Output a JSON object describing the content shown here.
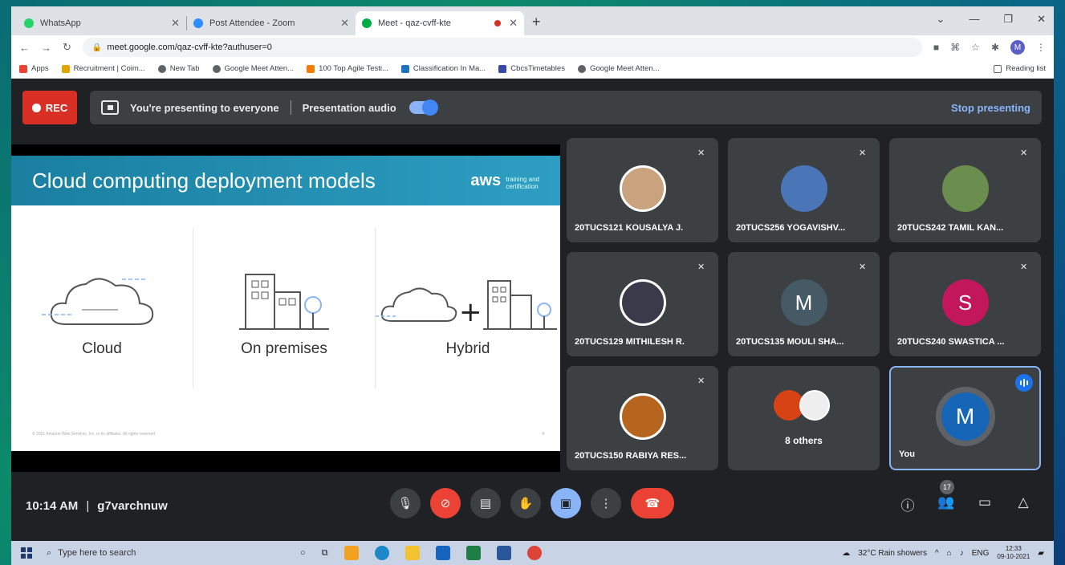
{
  "browser": {
    "tabs": [
      {
        "title": "WhatsApp",
        "color": "#25d366",
        "active": false
      },
      {
        "title": "Post Attendee - Zoom",
        "color": "#2d8cff",
        "active": false
      },
      {
        "title": "Meet - qaz-cvff-kte",
        "color": "#00ac47",
        "active": true
      }
    ],
    "url": "meet.google.com/qaz-cvff-kte?authuser=0",
    "profile_initial": "M",
    "bookmarks": [
      {
        "label": "Apps",
        "color": "#ea4335"
      },
      {
        "label": "Recruitment | Coim...",
        "color": "#e3a400"
      },
      {
        "label": "New Tab",
        "color": "#5f6368"
      },
      {
        "label": "Google Meet Atten...",
        "color": "#5f6368"
      },
      {
        "label": "100 Top Agile Testi...",
        "color": "#f57c00"
      },
      {
        "label": "Classification In Ma...",
        "color": "#1e73be"
      },
      {
        "label": "CbcsTimetables",
        "color": "#3949ab"
      },
      {
        "label": "Google Meet Atten...",
        "color": "#5f6368"
      }
    ],
    "reading_list": "Reading list"
  },
  "meet": {
    "rec_label": "REC",
    "presenting_text": "You're presenting to everyone",
    "presentation_audio": "Presentation audio",
    "stop_presenting": "Stop presenting",
    "slide": {
      "title": "Cloud computing deployment models",
      "aws_logo": "aws",
      "aws_sub1": "training and",
      "aws_sub2": "certification",
      "models": [
        "Cloud",
        "On premises",
        "Hybrid"
      ],
      "copyright": "© 2021 Amazon Web Services, Inc. or its affiliates. All rights reserved.",
      "slide_number": "4"
    },
    "participants": [
      {
        "name": "20TUCS121 KOUSALYA J.",
        "avatar": "photo",
        "color": "#c9a27e"
      },
      {
        "name": "20TUCS256 YOGAVISHV...",
        "avatar": "photo",
        "color": "#4a76b8"
      },
      {
        "name": "20TUCS242 TAMIL KAN...",
        "avatar": "photo",
        "color": "#6b8e4e"
      },
      {
        "name": "20TUCS129 MITHILESH R.",
        "avatar": "photo",
        "color": "#3a3a4a"
      },
      {
        "name": "20TUCS135 MOULI SHA...",
        "avatar": "initial",
        "initial": "M",
        "color": "#455a64"
      },
      {
        "name": "20TUCS240 SWASTICA ...",
        "avatar": "initial",
        "initial": "S",
        "color": "#c2185b"
      },
      {
        "name": "20TUCS150 RABIYA RES...",
        "avatar": "photo",
        "color": "#b5651d"
      }
    ],
    "others_label": "8 others",
    "you_label": "You",
    "you_initial": "M",
    "time": "10:14 AM",
    "meeting_code": "g7varchnuw",
    "participant_count": "17"
  },
  "taskbar": {
    "search_placeholder": "Type here to search",
    "weather": "32°C  Rain showers",
    "lang": "ENG",
    "clock_time": "12:33",
    "clock_date": "09-10-2021"
  }
}
